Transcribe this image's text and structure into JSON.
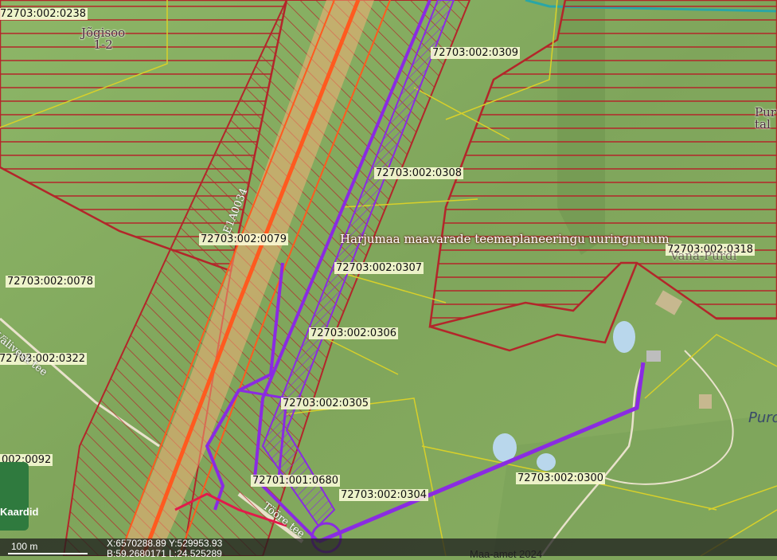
{
  "map": {
    "parcels": [
      {
        "id": "p0238",
        "label": "72703:002:0238"
      },
      {
        "id": "p0309",
        "label": "72703:002:0309"
      },
      {
        "id": "p0308",
        "label": "72703:002:0308"
      },
      {
        "id": "p0079",
        "label": "72703:002:0079"
      },
      {
        "id": "p0318",
        "label": "72703:002:0318"
      },
      {
        "id": "p0078",
        "label": "72703:002:0078"
      },
      {
        "id": "p0307",
        "label": "72703:002:0307"
      },
      {
        "id": "p0306",
        "label": "72703:002:0306"
      },
      {
        "id": "p0322",
        "label": "72703:002:0322"
      },
      {
        "id": "p0305",
        "label": "72703:002:0305"
      },
      {
        "id": "p0092",
        "label": "002:0092"
      },
      {
        "id": "p0680",
        "label": "72701:001:0680"
      },
      {
        "id": "p0304",
        "label": "72703:002:0304"
      },
      {
        "id": "p0300",
        "label": "72703:002:0300"
      }
    ],
    "places": {
      "jogisoo": "Jõgisoo\n1-2",
      "purtse_talu": "Pur\ntal",
      "vana_purdi": "Vana-Purdi",
      "purdi": "Purd"
    },
    "overlay_label": "Harjumaa maavarade teemaplaneeringu uuringuruum",
    "road_labels": {
      "road_e": "E1A0034",
      "valive": "Välivesk tee",
      "toore": "Tööre tee"
    },
    "colors": {
      "parcel_line": "#d8d02a",
      "restriction": "#b3262a",
      "road_zone": "#ff5a1f",
      "pipeline": "#8a2be2",
      "water": "#b9d7ec",
      "terrain": "#7fa55b"
    }
  },
  "ui": {
    "layers_button": "Kaardid",
    "scale": "100 m",
    "coords_xy": "X:6570288.89 Y:529953.93",
    "coords_bl": "B:59.2680171 L:24.525289",
    "attribution": "Maa-amet 2024"
  }
}
